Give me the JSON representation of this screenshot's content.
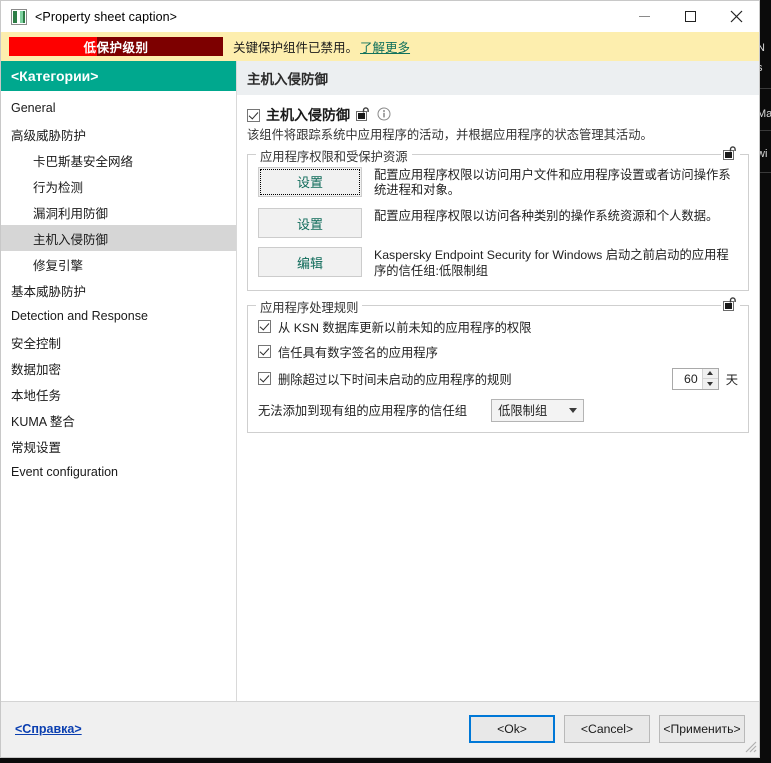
{
  "window": {
    "title": "<Property sheet caption>",
    "icon": "app-icon",
    "minimize": "minimize-icon",
    "maximize": "maximize-icon",
    "close": "close-icon"
  },
  "banner": {
    "protection_level_label": "低保护级别",
    "protection_fill_percent": 41,
    "message": "关键保护组件已禁用。",
    "link": "了解更多",
    "bar_bg": "#7d0000",
    "bar_fill": "#fe0000",
    "bg": "#fdeeae"
  },
  "sidebar": {
    "header": "<Категории>",
    "accent": "#00a88e",
    "items": [
      {
        "label": "General",
        "sub": false,
        "selected": false
      },
      {
        "label": "高级威胁防护",
        "sub": false,
        "selected": false
      },
      {
        "label": "卡巴斯基安全网络",
        "sub": true,
        "selected": false
      },
      {
        "label": "行为检测",
        "sub": true,
        "selected": false
      },
      {
        "label": "漏洞利用防御",
        "sub": true,
        "selected": false
      },
      {
        "label": "主机入侵防御",
        "sub": true,
        "selected": true
      },
      {
        "label": "修复引擎",
        "sub": true,
        "selected": false
      },
      {
        "label": "基本威胁防护",
        "sub": false,
        "selected": false
      },
      {
        "label": "Detection and Response",
        "sub": false,
        "selected": false
      },
      {
        "label": "安全控制",
        "sub": false,
        "selected": false
      },
      {
        "label": "数据加密",
        "sub": false,
        "selected": false
      },
      {
        "label": "本地任务",
        "sub": false,
        "selected": false
      },
      {
        "label": "KUMA 整合",
        "sub": false,
        "selected": false
      },
      {
        "label": "常规设置",
        "sub": false,
        "selected": false
      },
      {
        "label": "Event configuration",
        "sub": false,
        "selected": false
      }
    ]
  },
  "main": {
    "header": "主机入侵防御",
    "component": {
      "checkbox_checked": true,
      "title": "主机入侵防御",
      "lock_icon": "padlock-open-icon",
      "info_icon": "info-icon",
      "description": "该组件将跟踪系统中应用程序的活动，并根据应用程序的状态管理其活动。"
    },
    "group_resources": {
      "legend": "应用程序权限和受保护资源",
      "lock_icon": "padlock-open-icon",
      "rows": [
        {
          "button": "设置",
          "focused": true,
          "text": "配置应用程序权限以访问用户文件和应用程序设置或者访问操作系统进程和对象。"
        },
        {
          "button": "设置",
          "focused": false,
          "text": "配置应用程序权限以访问各种类别的操作系统资源和个人数据。"
        },
        {
          "button": "编辑",
          "focused": false,
          "text": "Kaspersky Endpoint Security for Windows 启动之前启动的应用程序的信任组:低限制组"
        }
      ]
    },
    "group_rules": {
      "legend": "应用程序处理规则",
      "lock_icon": "padlock-open-icon",
      "checkboxes": [
        {
          "label": "从 KSN 数据库更新以前未知的应用程序的权限",
          "checked": true
        },
        {
          "label": "信任具有数字签名的应用程序",
          "checked": true
        },
        {
          "label": "删除超过以下时间未启动的应用程序的规则",
          "checked": true
        }
      ],
      "spinner_value": "60",
      "spinner_unit": "天",
      "dropdown_label": "无法添加到现有组的应用程序的信任组",
      "dropdown_value": "低限制组"
    }
  },
  "footer": {
    "help": "<Справка>",
    "ok": "<Ok>",
    "cancel": "<Cancel>",
    "apply": "<Применить>",
    "primary_border": "#0078d7"
  },
  "backdrop": {
    "fragments": [
      "N",
      "s",
      "Ma",
      "wi"
    ]
  }
}
